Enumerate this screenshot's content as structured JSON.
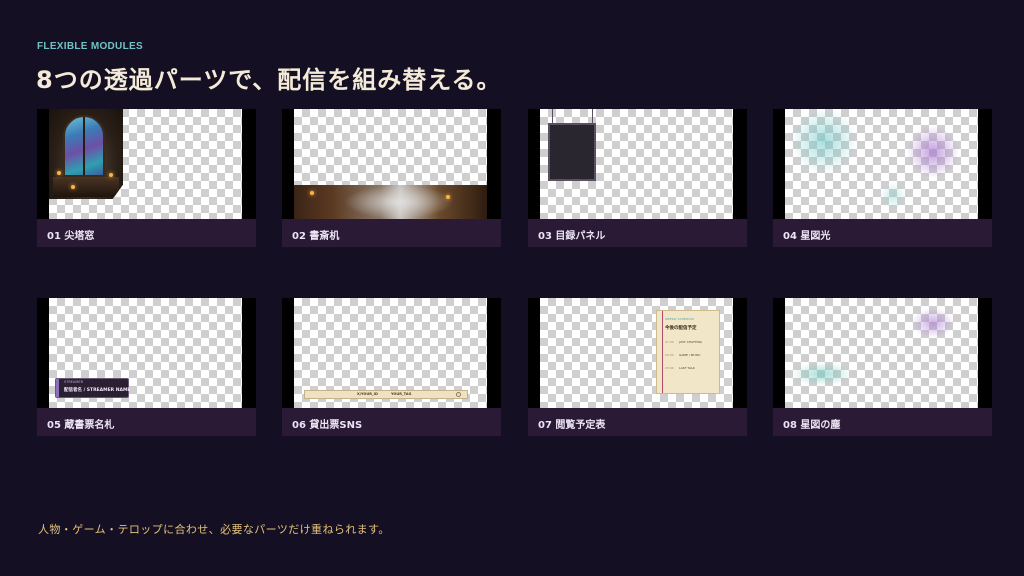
{
  "header": {
    "eyebrow": "FLEXIBLE MODULES",
    "title": "8つの透過パーツで、配信を組み替える。"
  },
  "footer": {
    "text": "人物・ゲーム・テロップに合わせ、必要なパーツだけ重ねられます。"
  },
  "modules": [
    {
      "label": "01 尖塔窓"
    },
    {
      "label": "02 書斎机"
    },
    {
      "label": "03 目録パネル"
    },
    {
      "label": "04 星図光"
    },
    {
      "label": "05 蔵書票名札"
    },
    {
      "label": "06 貸出票SNS"
    },
    {
      "label": "07 閲覧予定表"
    },
    {
      "label": "08 星図の塵"
    }
  ],
  "nameplate": {
    "small": "STREAMER",
    "main": "配信者名 / STREAMER NAME"
  },
  "sns": {
    "left": "X/YOUR_ID",
    "right": "YOUR_TAG"
  },
  "schedule": {
    "small": "WEEKLY SCHEDULE",
    "title": "今後の配信予定",
    "rows": [
      {
        "time": "21:00",
        "item": "JUST CHATTING"
      },
      {
        "time": "22:00",
        "item": "GAME / MUSIC"
      },
      {
        "time": "23:00",
        "item": "LAST TALK"
      }
    ]
  },
  "colors": {
    "background": "#140f22",
    "eyebrow": "#6fc3c7",
    "title": "#f3ead8",
    "footer": "#e4c27a",
    "label_bar": "#2a1a36"
  }
}
